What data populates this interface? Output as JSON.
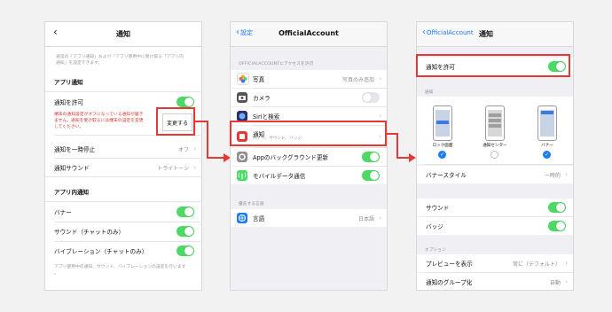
{
  "screen1": {
    "title": "通知",
    "back_icon": "chevron-left-icon",
    "intro": [
      "通常の「アプリ通知」および「アプリ使用中に受け取る「アプリ内",
      "通知」を設定できます。"
    ],
    "app_notif_header": "アプリ通知",
    "allow_label": "通知を許可",
    "warning": [
      "端末の通知設定がオフになっている通知が届き",
      "ません。通知を受け取るには端末の設定を変更",
      "してください。"
    ],
    "change_button": "変更する",
    "pause_label": "通知を一時停止",
    "pause_value": "オフ",
    "sound_label": "通知サウンド",
    "sound_value": "トライトーン",
    "inapp_header": "アプリ内通知",
    "banner_label": "バナー",
    "chat_sound_label": "サウンド（チャットのみ）",
    "vibration_label": "バイブレーション（チャットのみ）",
    "footer": [
      "アプリ使用中の通知、サウンド、バイブレーションの設定を行います",
      "。"
    ]
  },
  "screen2": {
    "back_label": "設定",
    "title": "OfficialAccount",
    "access_header": "OFFICIALACCOUNTにアクセスを許可",
    "rows": [
      {
        "label": "写真",
        "value": "写真のみ追加",
        "icon": "photos-icon",
        "color": "#f5a623"
      },
      {
        "label": "カメラ",
        "value": "",
        "icon": "camera-icon",
        "color": "#555555"
      },
      {
        "label": "Siriと検索",
        "value": "",
        "icon": "siri-icon",
        "color": "#2b2b6e"
      },
      {
        "label": "通知",
        "value": "",
        "sub": "バナー、サウンド、バッジ",
        "icon": "notification-icon",
        "color": "#e53935"
      },
      {
        "label": "Appのバックグラウンド更新",
        "value": "",
        "icon": "gear-icon",
        "color": "#8e8e93"
      },
      {
        "label": "モバイルデータ通信",
        "value": "",
        "icon": "antenna-icon",
        "color": "#4cd964"
      }
    ],
    "lang_header": "優先する言語",
    "lang_label": "言語",
    "lang_value": "日本語",
    "lang_icon": "globe-icon"
  },
  "screen3": {
    "back_label": "OfficialAccount",
    "title": "通知",
    "allow_label": "通知を許可",
    "alerts_header": "通知",
    "phones": [
      "ロック画面",
      "通知センター",
      "バナー"
    ],
    "phones_checked": [
      true,
      false,
      true
    ],
    "banner_style_label": "バナースタイル",
    "banner_style_value": "一時的",
    "sound_label": "サウンド",
    "badge_label": "バッジ",
    "options_header": "オプション",
    "preview_label": "プレビューを表示",
    "preview_value": "常に（デフォルト）",
    "group_label": "通知のグループ化",
    "group_value": "自動"
  },
  "colors": {
    "accent": "#1b7cf6",
    "toggle_on": "#4cd964",
    "highlight": "#e53935"
  }
}
